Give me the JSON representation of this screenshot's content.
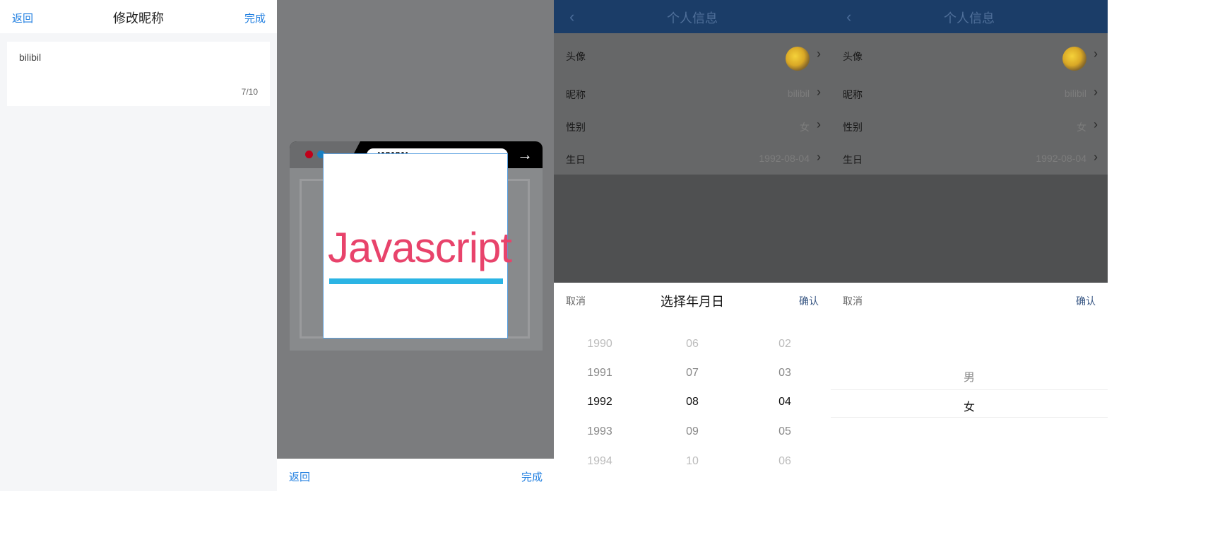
{
  "edit_nickname": {
    "back_label": "返回",
    "title": "修改昵称",
    "done_label": "完成",
    "input_value": "bilibil",
    "char_count": "7/10"
  },
  "crop": {
    "url_text": "www.",
    "image_text": "Javascript",
    "back_label": "返回",
    "done_label": "完成",
    "colors": {
      "dot_red": "#c0001a",
      "dot_blue": "#1a7fc0",
      "text": "#e8436b",
      "underline": "#2bb4e4"
    }
  },
  "profile": {
    "title": "个人信息",
    "rows": [
      {
        "label": "头像",
        "value": ""
      },
      {
        "label": "昵称",
        "value": "bilibil"
      },
      {
        "label": "性别",
        "value": "女"
      },
      {
        "label": "生日",
        "value": "1992-08-04"
      }
    ]
  },
  "date_picker": {
    "cancel_label": "取消",
    "title": "选择年月日",
    "confirm_label": "确认",
    "years": [
      "1990",
      "1991",
      "1992",
      "1993",
      "1994"
    ],
    "months": [
      "06",
      "07",
      "08",
      "09",
      "10"
    ],
    "days": [
      "02",
      "03",
      "04",
      "05",
      "06"
    ],
    "selected": {
      "year": "1992",
      "month": "08",
      "day": "04"
    }
  },
  "gender_picker": {
    "cancel_label": "取消",
    "confirm_label": "确认",
    "options": [
      "男",
      "女"
    ],
    "selected": "女"
  }
}
